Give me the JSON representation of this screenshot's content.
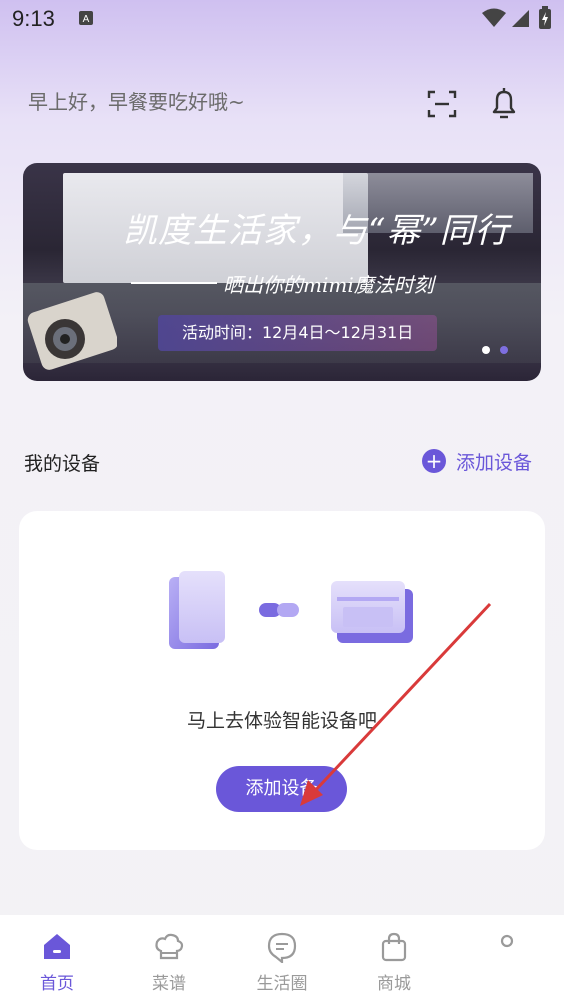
{
  "status_bar": {
    "time": "9:13"
  },
  "header": {
    "greeting": "早上好，早餐要吃好哦~"
  },
  "banner": {
    "title": "凯度生活家，与“幂”同行",
    "subtitle": "晒出你的mimi魔法时刻",
    "activity_time": "活动时间：12月4日～12月31日",
    "page_count": 2,
    "active_page": 2
  },
  "devices": {
    "section_title": "我的设备",
    "add_link_label": "添加设备",
    "empty_prompt": "马上去体验智能设备吧",
    "add_button_label": "添加设备"
  },
  "tabs": [
    {
      "label": "首页",
      "icon": "home-icon",
      "active": true
    },
    {
      "label": "菜谱",
      "icon": "chef-hat-icon",
      "active": false
    },
    {
      "label": "生活圈",
      "icon": "chat-bubble-icon",
      "active": false
    },
    {
      "label": "商城",
      "icon": "shopping-bag-icon",
      "active": false
    },
    {
      "label": "",
      "icon": "profile-icon",
      "active": false
    }
  ],
  "colors": {
    "accent": "#6a57d9",
    "arrow": "#d93a3a"
  }
}
